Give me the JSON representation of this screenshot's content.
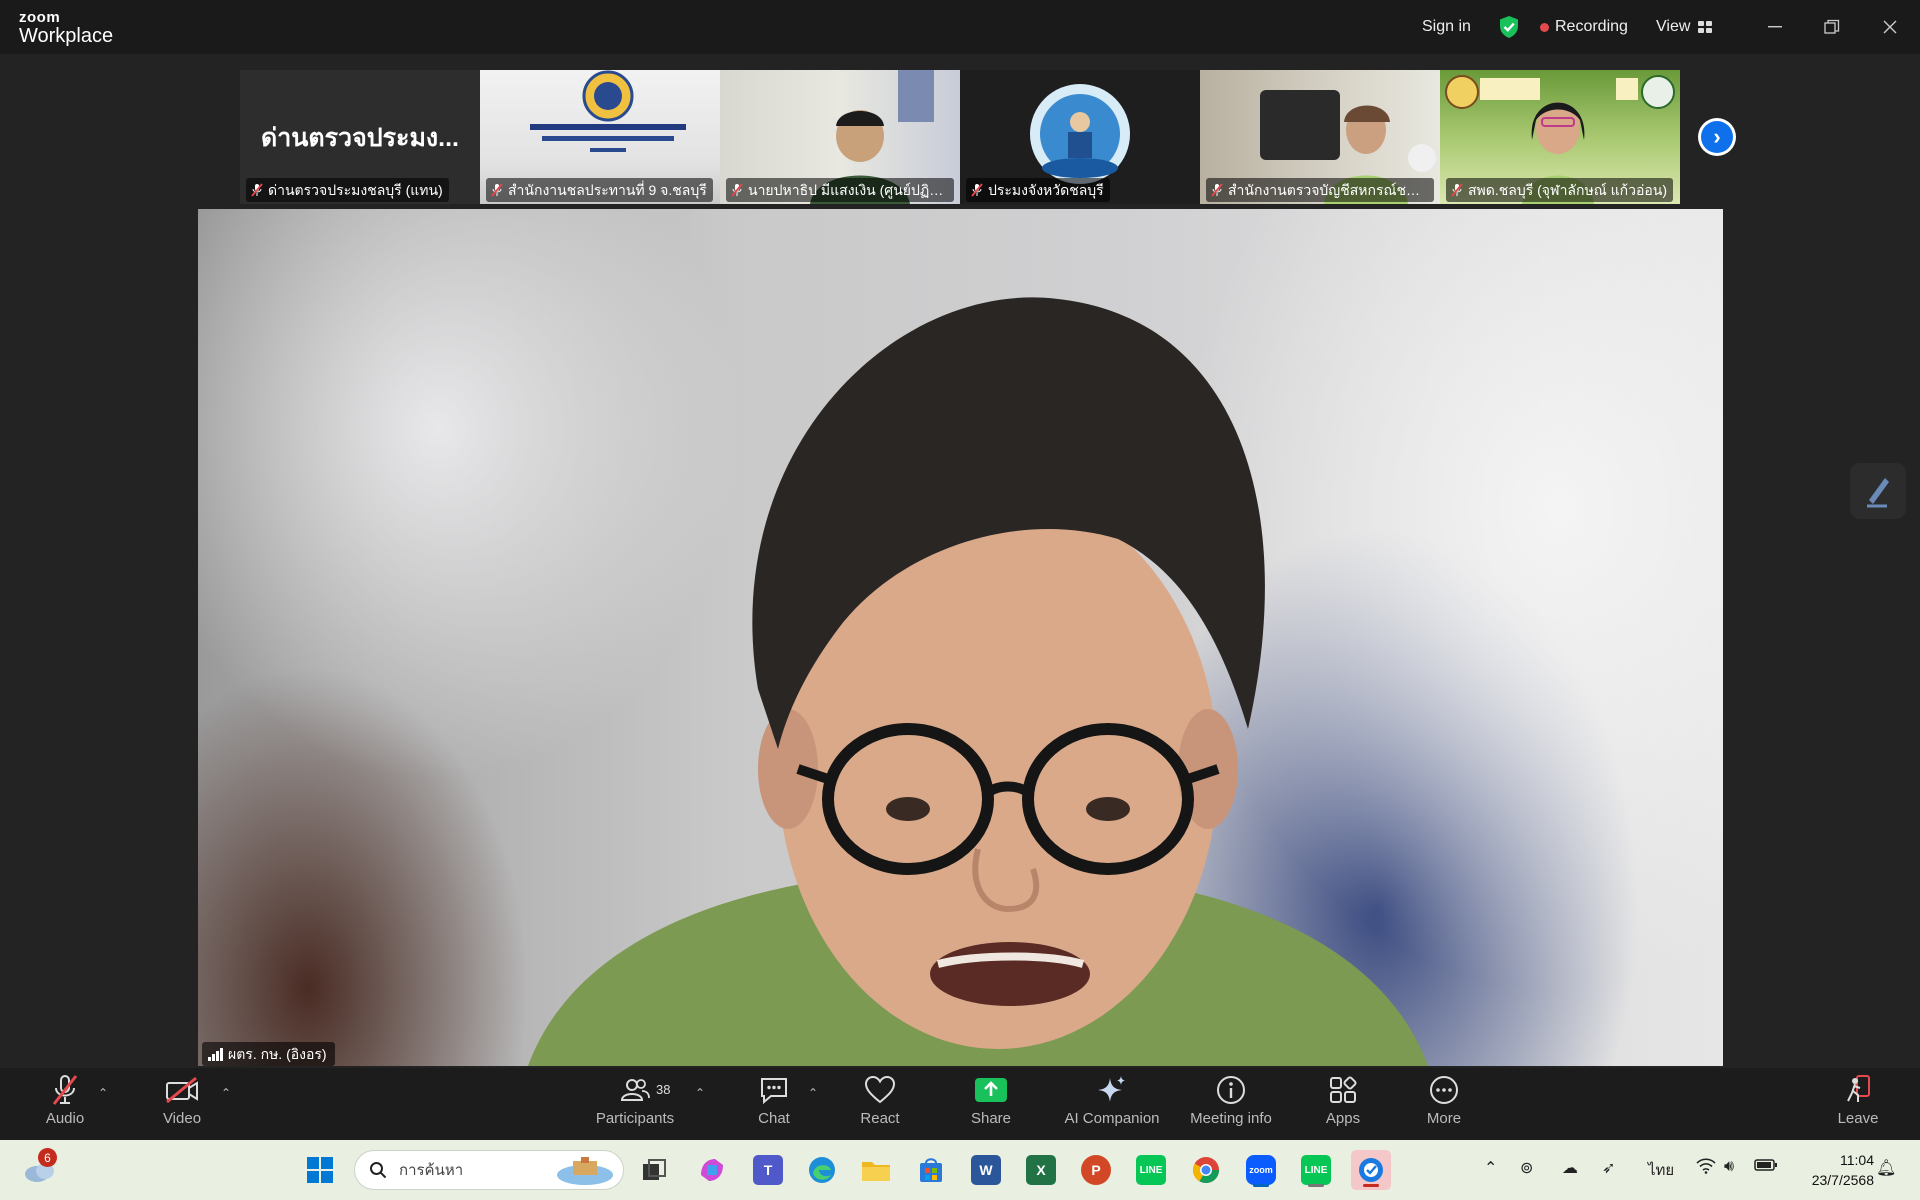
{
  "titlebar": {
    "logo_top": "zoom",
    "logo_bottom": "Workplace",
    "sign_in": "Sign in",
    "recording": "Recording",
    "view": "View"
  },
  "thumbnails": [
    {
      "name": "ด่านตรวจประมงชลบุรี (แทน)",
      "big_name": "ด่านตรวจประมง...",
      "muted": true
    },
    {
      "name": "สำนักงานชลประทานที่ 9 จ.ชลบุรี",
      "muted": true
    },
    {
      "name": "นายปหาธิป มีแสงเงิน (ศูนย์ปฏิบัติ...",
      "muted": true
    },
    {
      "name": "ประมงจังหวัดชลบุรี",
      "muted": true
    },
    {
      "name": "สำนักงานตรวจบัญชีสหกรณ์ชลบุรี",
      "muted": true
    },
    {
      "name": "สพด.ชลบุรี (จุฬาลักษณ์ แก้วอ่อน)",
      "muted": true
    }
  ],
  "main_video": {
    "speaker_name": "ผตร. กษ. (อิงอร)"
  },
  "toolbar": {
    "audio": "Audio",
    "video": "Video",
    "participants": "Participants",
    "participants_count": "38",
    "chat": "Chat",
    "react": "React",
    "share": "Share",
    "ai_companion": "AI Companion",
    "meeting_info": "Meeting info",
    "apps": "Apps",
    "more": "More",
    "leave": "Leave"
  },
  "taskbar": {
    "weather_badge": "6",
    "search_placeholder": "การค้นหา",
    "language": "ไทย",
    "time": "11:04",
    "date": "23/7/2568"
  },
  "colors": {
    "accent": "#0e71eb",
    "recording_dot": "#e5484d",
    "share_green": "#19c15b",
    "toolbar_bg": "#1c1c1c",
    "taskbar_bg": "#e9efe1"
  }
}
